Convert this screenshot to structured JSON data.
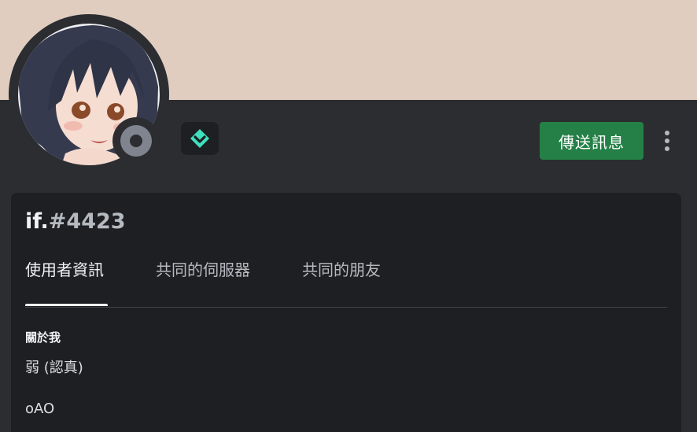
{
  "colors": {
    "banner": "#e0cdbf",
    "background": "#2b2d31",
    "card": "#1e1f22",
    "send_button": "#248046",
    "badge_icon": "#3ee0c0",
    "status_offline": "#80848e"
  },
  "profile": {
    "username": "if.",
    "discriminator": "#4423",
    "status": "offline",
    "badge_icon": "diamond-chevron-icon"
  },
  "actions": {
    "send_message_label": "傳送訊息",
    "more_icon": "more-vertical-icon"
  },
  "tabs": [
    {
      "label": "使用者資訊",
      "active": true
    },
    {
      "label": "共同的伺服器",
      "active": false
    },
    {
      "label": "共同的朋友",
      "active": false
    }
  ],
  "about": {
    "heading": "關於我",
    "lines": [
      "弱 (認真)",
      "oAO"
    ]
  }
}
